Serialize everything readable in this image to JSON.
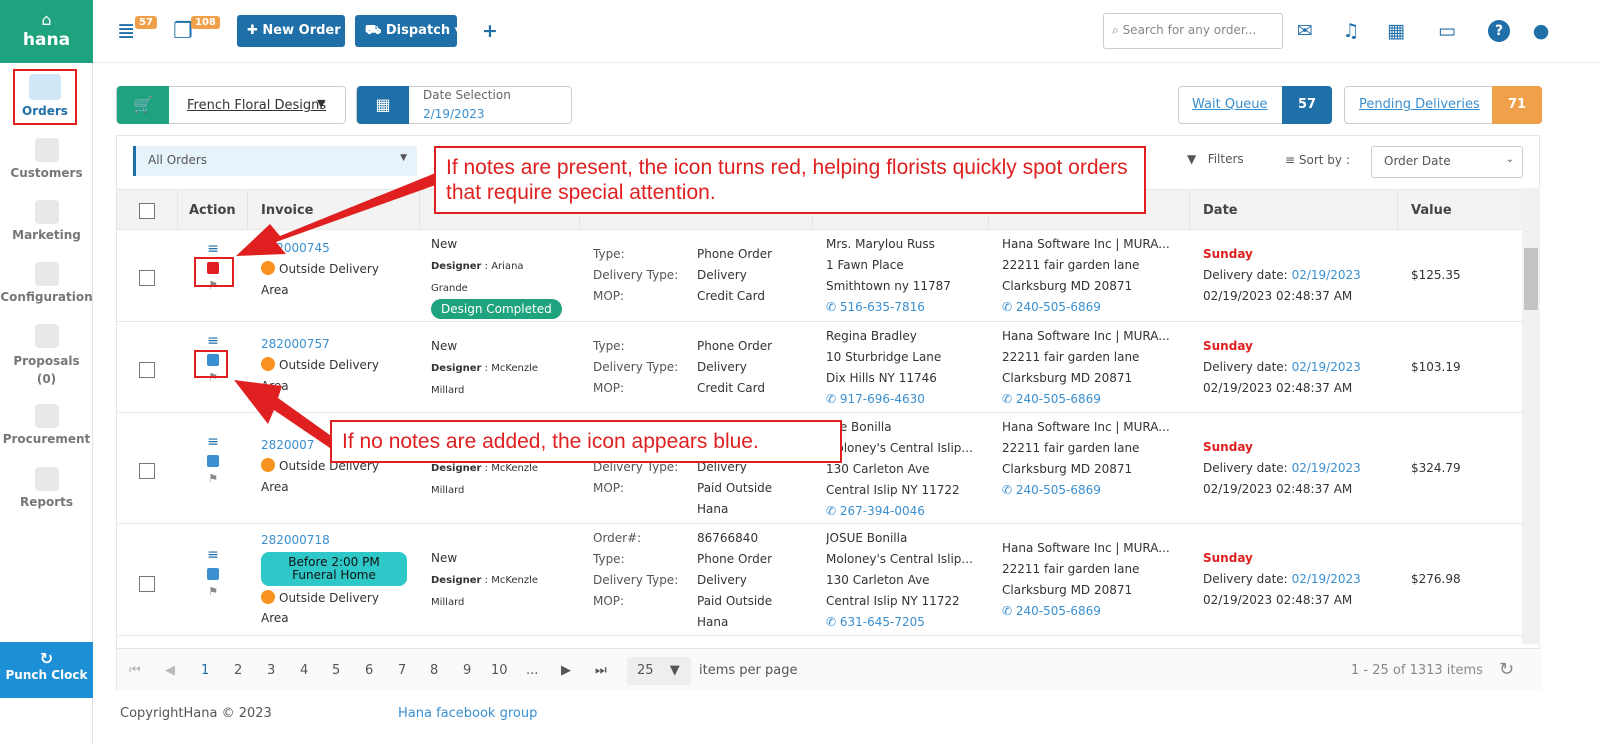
{
  "sidebar": {
    "brand": "hana",
    "items": [
      {
        "label": "Orders"
      },
      {
        "label": "Customers"
      },
      {
        "label": "Marketing"
      },
      {
        "label": "Configuration"
      },
      {
        "label": "Proposals"
      },
      {
        "label": "(0)"
      },
      {
        "label": "Procurement"
      },
      {
        "label": "Reports"
      }
    ],
    "punch_clock": "Punch Clock"
  },
  "topbar": {
    "badge_1": "57",
    "badge_2": "108",
    "new_order": "New Order",
    "dispatch": "Dispatch",
    "plus": "+",
    "search_placeholder": "Search for any order..."
  },
  "subbar": {
    "shop": "French Floral Designs",
    "date_title": "Date Selection",
    "date_value": "2/19/2023",
    "wait_queue": "Wait Queue",
    "wait_count": "57",
    "pending": "Pending Deliveries",
    "pending_count": "71"
  },
  "panel": {
    "filter_select": "All Orders",
    "filters": "Filters",
    "sort_label": "Sort by :",
    "sort_value": "Order Date",
    "headers": [
      "Action",
      "Invoice",
      "Date",
      "Value"
    ]
  },
  "rows": [
    {
      "invoice": "282000745",
      "area1": "Outside Delivery",
      "area2": "Area",
      "status": "New",
      "designer_label": "Designer",
      "designer": ": Ariana",
      "designer2": "Grande",
      "badge": "Design Completed",
      "type_label": "Type:",
      "type": "Phone Order",
      "dtype_label": "Delivery Type:",
      "dtype": "Delivery",
      "mop_label": "MOP:",
      "mop": "Credit Card",
      "recipient": [
        "Mrs. Marylou Russ",
        "1 Fawn Place",
        "Smithtown ny 11787"
      ],
      "rphone": "516-635-7816",
      "sender": [
        "Hana Software Inc | MURA...",
        "22211 fair garden lane",
        "Clarksburg MD 20871"
      ],
      "sphone": "240-505-6869",
      "day": "Sunday",
      "ddate_label": "Delivery date:",
      "ddate": "02/19/2023",
      "datetime": "02/19/2023 02:48:37 AM",
      "value": "$125.35"
    },
    {
      "invoice": "282000757",
      "area1": "Outside Delivery",
      "area2": "Area",
      "status": "New",
      "designer_label": "Designer",
      "designer": ": McKenzle",
      "designer2": "Millard",
      "type_label": "Type:",
      "type": "Phone Order",
      "dtype_label": "Delivery Type:",
      "dtype": "Delivery",
      "mop_label": "MOP:",
      "mop": "Credit Card",
      "recipient": [
        "Regina Bradley",
        "10 Sturbridge Lane",
        "Dix Hills NY 11746"
      ],
      "rphone": "917-696-4630",
      "sender": [
        "Hana Software Inc | MURA...",
        "22211 fair garden lane",
        "Clarksburg MD 20871"
      ],
      "sphone": "240-505-6869",
      "day": "Sunday",
      "ddate_label": "Delivery date:",
      "ddate": "02/19/2023",
      "datetime": "02/19/2023 02:48:37 AM",
      "value": "$103.19"
    },
    {
      "invoice": "2820007",
      "area1": "Outside Delivery",
      "area2": "Area",
      "designer_label": "Designer",
      "designer": ": McKenzle",
      "designer2": "Millard",
      "dtype": "Delivery",
      "mop_label": "MOP:",
      "mop": "Paid Outside",
      "mop2": "Hana",
      "recipient": [
        "sue Bonilla",
        "Moloney's Central Islip...",
        "130 Carleton Ave",
        "Central Islip NY 11722"
      ],
      "rphone": "267-394-0046",
      "sender": [
        "Hana Software Inc | MURA...",
        "22211 fair garden lane",
        "Clarksburg MD 20871"
      ],
      "sphone": "240-505-6869",
      "day": "Sunday",
      "ddate_label": "Delivery date:",
      "ddate": "02/19/2023",
      "datetime": "02/19/2023 02:48:37 AM",
      "value": "$324.79"
    },
    {
      "invoice": "282000718",
      "tag1": "Before 2:00 PM",
      "tag2": "Funeral Home",
      "area1": "Outside Delivery",
      "area2": "Area",
      "status": "New",
      "designer_label": "Designer",
      "designer": ": McKenzle",
      "designer2": "Millard",
      "order_label": "Order#:",
      "order": "86766840",
      "type_label": "Type:",
      "type": "Phone Order",
      "dtype_label": "Delivery Type:",
      "dtype": "Delivery",
      "mop_label": "MOP:",
      "mop": "Paid Outside",
      "mop2": "Hana",
      "recipient": [
        "JOSUE Bonilla",
        "Moloney's Central Islip...",
        "130 Carleton Ave",
        "Central Islip NY 11722"
      ],
      "rphone": "631-645-7205",
      "sender": [
        "Hana Software Inc | MURA...",
        "22211 fair garden lane",
        "Clarksburg MD 20871"
      ],
      "sphone": "240-505-6869",
      "day": "Sunday",
      "ddate_label": "Delivery date:",
      "ddate": "02/19/2023",
      "datetime": "02/19/2023 02:48:37 AM",
      "value": "$276.98"
    }
  ],
  "pager": {
    "pages": [
      "1",
      "2",
      "3",
      "4",
      "5",
      "6",
      "7",
      "8",
      "9",
      "10",
      "..."
    ],
    "per_page": "25",
    "per_page_label": "items per page",
    "summary": "1 - 25 of 1313 items"
  },
  "footer": {
    "copyright": "CopyrightHana © 2023",
    "fb": "Hana facebook group"
  },
  "annotations": {
    "red_note": "If notes are present, the icon turns red, helping florists quickly spot orders that require special attention.",
    "blue_note": "If no notes are added, the icon appears blue."
  },
  "colors": {
    "note_red": "#e02020",
    "note_blue": "#3a8fd0",
    "accent": "#1f6fa8",
    "brand": "#1fa37f"
  }
}
